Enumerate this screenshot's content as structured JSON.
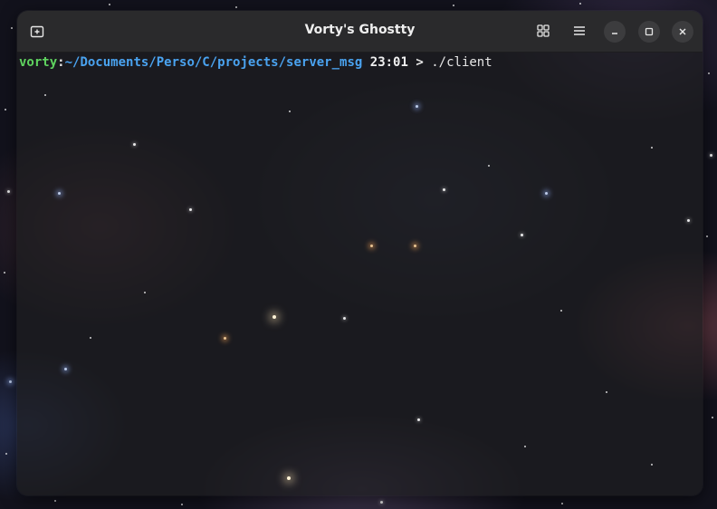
{
  "window": {
    "title": "Vorty's Ghostty"
  },
  "terminal": {
    "user": "vorty",
    "separator": ":",
    "path": "~/Documents/Perso/C/projects/server_msg",
    "time": "23:01",
    "prompt_symbol": ">",
    "command": "./client"
  },
  "icons": {
    "new_tab": "new-tab-icon",
    "overview": "grid-icon",
    "menu": "hamburger-icon",
    "minimize": "minimize-icon",
    "maximize": "maximize-icon",
    "close": "close-icon"
  },
  "colors": {
    "user": "#5fd35f",
    "path": "#4aa3f0",
    "titlebar": "#2a2a2c"
  }
}
